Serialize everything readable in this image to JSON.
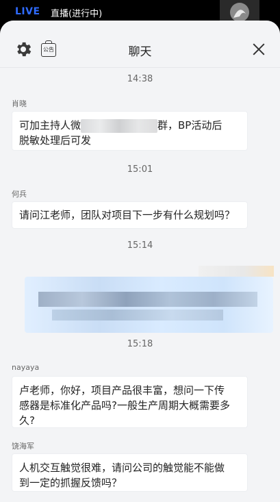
{
  "topbar": {
    "live": "LIVE",
    "status": "直播(进行中)"
  },
  "header": {
    "title": "聊天",
    "notice_label": "公告"
  },
  "messages": [
    {
      "time": "14:38",
      "sender": "肖晓",
      "line1_prefix": "可加主持人微",
      "line1_suffix": "群，BP活动后",
      "line2": "脱敏处理后可发"
    },
    {
      "time": "15:01",
      "sender": "何兵",
      "text": "请问江老师，团队对项目下一步有什么规划吗？"
    },
    {
      "time": "15:14"
    },
    {
      "time": "15:18",
      "sender": "nayaya",
      "line1": "卢老师，你好，项目产品很丰富，想问一下传",
      "line2": "感器是标准化产品吗?一般生产周期大概需要多",
      "line3": "久?"
    },
    {
      "sender": "饶海军",
      "line1": "人机交互触觉很难，请问公司的触觉能不能做",
      "line2": "到一定的抓握反馈吗？"
    }
  ],
  "icons": {
    "settings": "gear-icon",
    "notice": "notice-board-icon",
    "close": "close-icon"
  },
  "colors": {
    "live": "#2f6bff",
    "panel_bg": "#f3f4f6",
    "bubble_bg": "#ffffff"
  }
}
